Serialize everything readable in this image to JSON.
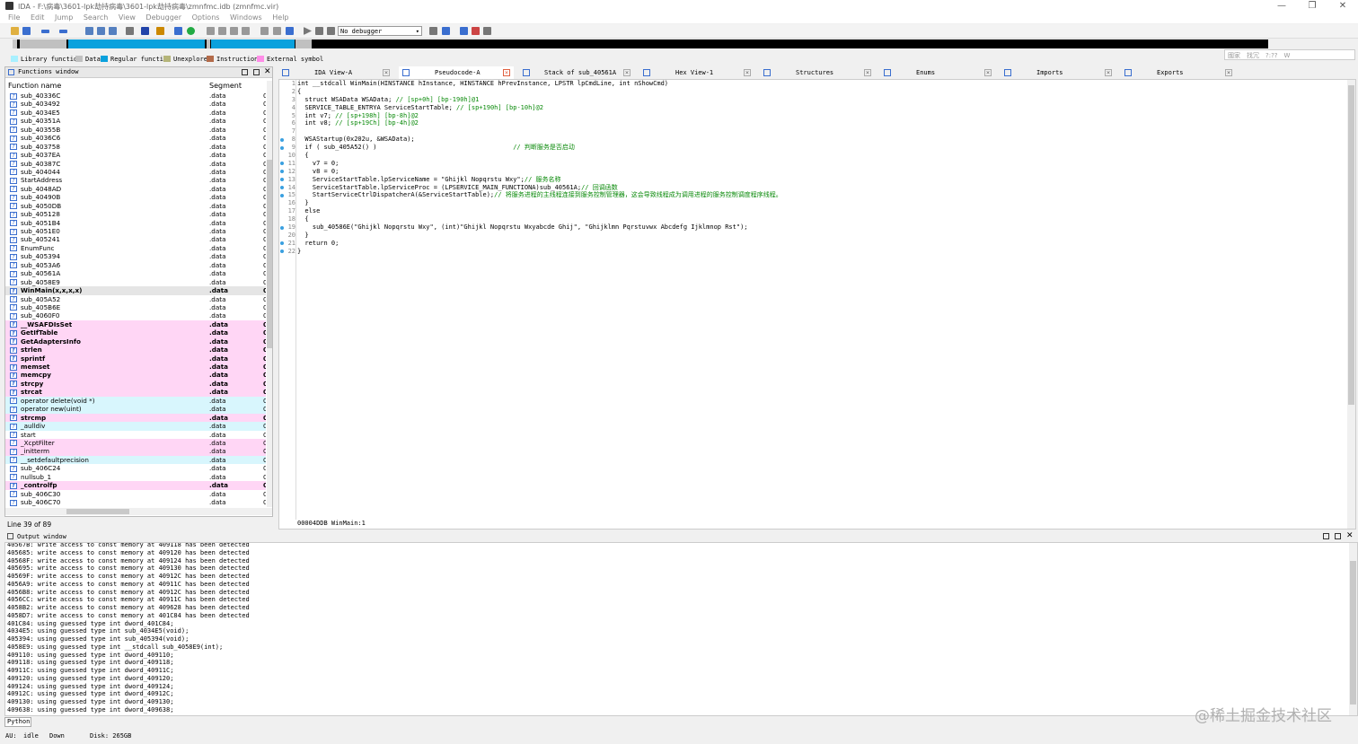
{
  "window": {
    "title": "IDA - F:\\病毒\\3601-lpk劫持病毒\\3601-lpk劫持病毒\\zmnfmc.idb (zmnfmc.vir)",
    "controls": [
      "—",
      "❐",
      "✕"
    ]
  },
  "menu": [
    "File",
    "Edit",
    "Jump",
    "Search",
    "View",
    "Debugger",
    "Options",
    "Windows",
    "Help"
  ],
  "toolbar": {
    "debugger_select": "No debugger"
  },
  "search_hint": "國家　找冗　?:??　W",
  "legend": [
    {
      "label": "Library function",
      "color": "#a8f0ff"
    },
    {
      "label": "Data",
      "color": "#c0c0c0"
    },
    {
      "label": "Regular function",
      "color": "#0aa1dd"
    },
    {
      "label": "Unexplored",
      "color": "#b5b57a"
    },
    {
      "label": "Instruction",
      "color": "#b36b4a"
    },
    {
      "label": "External symbol",
      "color": "#ff8ee8"
    }
  ],
  "functions_window": {
    "title": "Functions window",
    "col_name": "Function name",
    "col_segment": "Segment",
    "line_status": "Line 39 of 89",
    "rows": [
      {
        "name": "sub_40336C",
        "seg": ".data",
        "x": "0",
        "style": ""
      },
      {
        "name": "sub_403492",
        "seg": ".data",
        "x": "0",
        "style": ""
      },
      {
        "name": "sub_4034E5",
        "seg": ".data",
        "x": "0",
        "style": ""
      },
      {
        "name": "sub_40351A",
        "seg": ".data",
        "x": "0",
        "style": ""
      },
      {
        "name": "sub_40355B",
        "seg": ".data",
        "x": "0",
        "style": ""
      },
      {
        "name": "sub_4036C6",
        "seg": ".data",
        "x": "0",
        "style": ""
      },
      {
        "name": "sub_403758",
        "seg": ".data",
        "x": "0",
        "style": ""
      },
      {
        "name": "sub_4037EA",
        "seg": ".data",
        "x": "0",
        "style": ""
      },
      {
        "name": "sub_40387C",
        "seg": ".data",
        "x": "0",
        "style": ""
      },
      {
        "name": "sub_404044",
        "seg": ".data",
        "x": "0",
        "style": ""
      },
      {
        "name": "StartAddress",
        "seg": ".data",
        "x": "0",
        "style": ""
      },
      {
        "name": "sub_4048AD",
        "seg": ".data",
        "x": "0",
        "style": ""
      },
      {
        "name": "sub_40490B",
        "seg": ".data",
        "x": "0",
        "style": ""
      },
      {
        "name": "sub_4050DB",
        "seg": ".data",
        "x": "0",
        "style": ""
      },
      {
        "name": "sub_405128",
        "seg": ".data",
        "x": "0",
        "style": ""
      },
      {
        "name": "sub_4051B4",
        "seg": ".data",
        "x": "0",
        "style": ""
      },
      {
        "name": "sub_4051E0",
        "seg": ".data",
        "x": "0",
        "style": ""
      },
      {
        "name": "sub_405241",
        "seg": ".data",
        "x": "0",
        "style": ""
      },
      {
        "name": "EnumFunc",
        "seg": ".data",
        "x": "0",
        "style": ""
      },
      {
        "name": "sub_405394",
        "seg": ".data",
        "x": "0",
        "style": ""
      },
      {
        "name": "sub_4053A6",
        "seg": ".data",
        "x": "0",
        "style": ""
      },
      {
        "name": "sub_40561A",
        "seg": ".data",
        "x": "0",
        "style": ""
      },
      {
        "name": "sub_4058E9",
        "seg": ".data",
        "x": "0",
        "style": ""
      },
      {
        "name": "WinMain(x,x,x,x)",
        "seg": ".data",
        "x": "0",
        "style": "bold sel"
      },
      {
        "name": "sub_405A52",
        "seg": ".data",
        "x": "0",
        "style": ""
      },
      {
        "name": "sub_405B6E",
        "seg": ".data",
        "x": "0",
        "style": ""
      },
      {
        "name": "sub_4060F0",
        "seg": ".data",
        "x": "0",
        "style": ""
      },
      {
        "name": "__WSAFDIsSet",
        "seg": ".data",
        "x": "0",
        "style": "bold pink"
      },
      {
        "name": "GetIfTable",
        "seg": ".data",
        "x": "0",
        "style": "bold pink"
      },
      {
        "name": "GetAdaptersInfo",
        "seg": ".data",
        "x": "0",
        "style": "bold pink"
      },
      {
        "name": "strlen",
        "seg": ".data",
        "x": "0",
        "style": "bold pink"
      },
      {
        "name": "sprintf",
        "seg": ".data",
        "x": "0",
        "style": "bold pink"
      },
      {
        "name": "memset",
        "seg": ".data",
        "x": "0",
        "style": "bold pink"
      },
      {
        "name": "memcpy",
        "seg": ".data",
        "x": "0",
        "style": "bold pink"
      },
      {
        "name": "strcpy",
        "seg": ".data",
        "x": "0",
        "style": "bold pink"
      },
      {
        "name": "strcat",
        "seg": ".data",
        "x": "0",
        "style": "bold pink"
      },
      {
        "name": "operator delete(void *)",
        "seg": ".data",
        "x": "0",
        "style": "cyan"
      },
      {
        "name": "operator new(uint)",
        "seg": ".data",
        "x": "0",
        "style": "cyan"
      },
      {
        "name": "strcmp",
        "seg": ".data",
        "x": "0",
        "style": "bold pink"
      },
      {
        "name": "_aulldiv",
        "seg": ".data",
        "x": "0",
        "style": "cyan"
      },
      {
        "name": "start",
        "seg": ".data",
        "x": "0",
        "style": ""
      },
      {
        "name": "_XcptFilter",
        "seg": ".data",
        "x": "0",
        "style": "pink"
      },
      {
        "name": "_initterm",
        "seg": ".data",
        "x": "0",
        "style": "pink"
      },
      {
        "name": "__setdefaultprecision",
        "seg": ".data",
        "x": "0",
        "style": "cyan"
      },
      {
        "name": "sub_406C24",
        "seg": ".data",
        "x": "0",
        "style": ""
      },
      {
        "name": "nullsub_1",
        "seg": ".data",
        "x": "0",
        "style": ""
      },
      {
        "name": "_controlfp",
        "seg": ".data",
        "x": "0",
        "style": "bold pink"
      },
      {
        "name": "sub_406C30",
        "seg": ".data",
        "x": "0",
        "style": ""
      },
      {
        "name": "sub_406C70",
        "seg": ".data",
        "x": "0",
        "style": ""
      }
    ]
  },
  "tabs": [
    {
      "label": "IDA View-A",
      "active": false
    },
    {
      "label": "Pseudocode-A",
      "active": true
    },
    {
      "label": "Stack of sub_40561A",
      "active": false
    },
    {
      "label": "Hex View-1",
      "active": false
    },
    {
      "label": "Structures",
      "active": false
    },
    {
      "label": "Enums",
      "active": false
    },
    {
      "label": "Imports",
      "active": false
    },
    {
      "label": "Exports",
      "active": false
    }
  ],
  "pseudocode": {
    "lines": [
      {
        "n": "1",
        "dot": false,
        "text": "int __stdcall WinMain(HINSTANCE hInstance, HINSTANCE hPrevInstance, LPSTR lpCmdLine, int nShowCmd)"
      },
      {
        "n": "2",
        "dot": false,
        "text": "{"
      },
      {
        "n": "3",
        "dot": false,
        "text": "  struct WSAData WSAData; // [sp+0h] [bp-190h]@1"
      },
      {
        "n": "4",
        "dot": false,
        "text": "  SERVICE_TABLE_ENTRYA ServiceStartTable; // [sp+190h] [bp-10h]@2"
      },
      {
        "n": "5",
        "dot": false,
        "text": "  int v7; // [sp+198h] [bp-8h]@2"
      },
      {
        "n": "6",
        "dot": false,
        "text": "  int v8; // [sp+19Ch] [bp-4h]@2"
      },
      {
        "n": "7",
        "dot": false,
        "text": ""
      },
      {
        "n": "8",
        "dot": true,
        "text": "  WSAStartup(0x202u, &WSAData);"
      },
      {
        "n": "9",
        "dot": true,
        "text": "  if ( sub_405A52() )                                    // 判断服务是否启动"
      },
      {
        "n": "10",
        "dot": false,
        "text": "  {"
      },
      {
        "n": "11",
        "dot": true,
        "text": "    v7 = 0;"
      },
      {
        "n": "12",
        "dot": true,
        "text": "    v8 = 0;"
      },
      {
        "n": "13",
        "dot": true,
        "text": "    ServiceStartTable.lpServiceName = \"Ghijkl Nopqrstu Wxy\";// 服务名称"
      },
      {
        "n": "14",
        "dot": true,
        "text": "    ServiceStartTable.lpServiceProc = (LPSERVICE_MAIN_FUNCTIONA)sub_40561A;// 回调函数"
      },
      {
        "n": "15",
        "dot": true,
        "text": "    StartServiceCtrlDispatcherA(&ServiceStartTable);// 将服务进程的主线程连接到服务控制管理器，这会导致线程成为调用进程的服务控制调度程序线程。"
      },
      {
        "n": "16",
        "dot": false,
        "text": "  }"
      },
      {
        "n": "17",
        "dot": false,
        "text": "  else"
      },
      {
        "n": "18",
        "dot": false,
        "text": "  {"
      },
      {
        "n": "19",
        "dot": true,
        "text": "    sub_40586E(\"Ghijkl Nopqrstu Wxy\", (int)\"Ghijkl Nopqrstu Wxyabcde Ghij\", \"Ghijklmn Pqrstuvwx Abcdefg Ijklmnop Rst\");"
      },
      {
        "n": "20",
        "dot": false,
        "text": "  }"
      },
      {
        "n": "21",
        "dot": true,
        "text": "  return 0;"
      },
      {
        "n": "22",
        "dot": true,
        "text": "}"
      }
    ],
    "status": "00004DDB WinMain:1"
  },
  "output_window": {
    "title": "Output window",
    "lines": [
      "40567B: write access to const memory at 409118 has been detected",
      "405685: write access to const memory at 409120 has been detected",
      "40568F: write access to const memory at 409124 has been detected",
      "405695: write access to const memory at 409130 has been detected",
      "40569F: write access to const memory at 40912C has been detected",
      "4056A9: write access to const memory at 40911C has been detected",
      "4056B8: write access to const memory at 40912C has been detected",
      "4056CC: write access to const memory at 40911C has been detected",
      "4058B2: write access to const memory at 409628 has been detected",
      "4058D7: write access to const memory at 401C84 has been detected",
      "401C84: using guessed type int dword_401C84;",
      "4034E5: using guessed type int sub_4034E5(void);",
      "405394: using guessed type int sub_405394(void);",
      "4058E9: using guessed type int __stdcall sub_4058E9(int);",
      "409110: using guessed type int dword_409110;",
      "409118: using guessed type int dword_409118;",
      "40911C: using guessed type int dword_40911C;",
      "409120: using guessed type int dword_409120;",
      "409124: using guessed type int dword_409124;",
      "40912C: using guessed type int dword_40912C;",
      "409130: using guessed type int dword_409130;",
      "409638: using guessed type int dword_409638;"
    ]
  },
  "python_tab": "Python",
  "status_bar": {
    "au": "AU:",
    "state": "idle",
    "direction": "Down",
    "disk": "Disk: 265GB"
  },
  "watermark": "@稀土掘金技术社区"
}
